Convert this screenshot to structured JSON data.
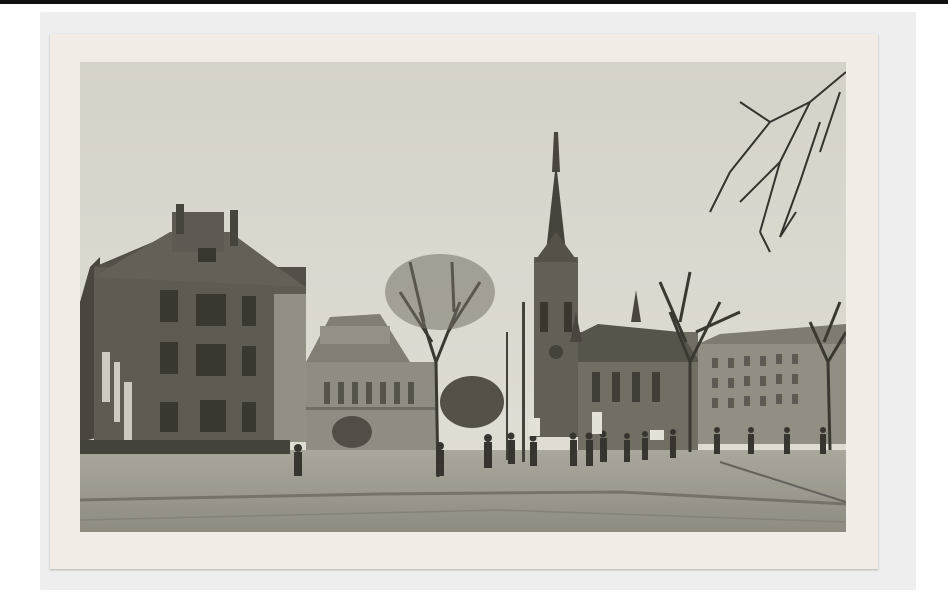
{
  "image": {
    "subject": "postcard-photo",
    "tone": "sepia-monochrome"
  },
  "colors": {
    "card": "#f1ede6",
    "sky": "#dcd9d2",
    "ground": "#9a968e",
    "building_dark": "#4a4640",
    "building_mid": "#77726a"
  }
}
